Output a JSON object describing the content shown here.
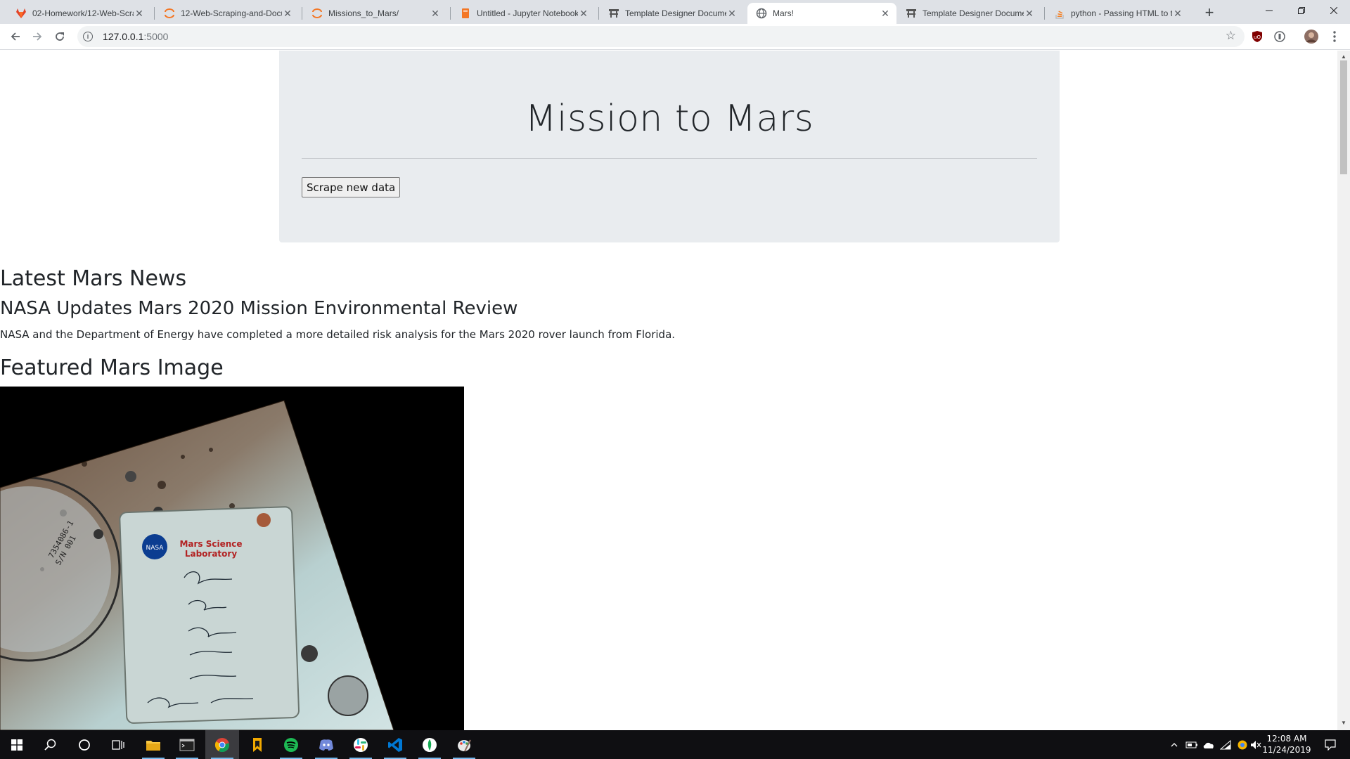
{
  "browser": {
    "tabs": [
      {
        "title": "02-Homework/12-Web-Scrap",
        "favicon": "gitlab-icon"
      },
      {
        "title": "12-Web-Scraping-and-Docu",
        "favicon": "jupyter-icon"
      },
      {
        "title": "Missions_to_Mars/",
        "favicon": "jupyter-icon"
      },
      {
        "title": "Untitled - Jupyter Notebook",
        "favicon": "jupyter-notebook-icon"
      },
      {
        "title": "Template Designer Docume",
        "favicon": "jinja-icon"
      },
      {
        "title": "Mars!",
        "favicon": "globe-icon",
        "active": true
      },
      {
        "title": "Template Designer Docume",
        "favicon": "jinja-icon"
      },
      {
        "title": "python - Passing HTML to t",
        "favicon": "stackoverflow-icon"
      }
    ],
    "url_host": "127.0.0.1",
    "url_port": ":5000"
  },
  "page": {
    "title": "Mission to Mars",
    "scrape_button": "Scrape new data",
    "news_heading": "Latest Mars News",
    "news_title": "NASA Updates Mars 2020 Mission Environmental Review",
    "news_teaser": "NASA and the Department of Energy have completed a more detailed risk analysis for the Mars 2020 rover launch from Florida.",
    "featured_heading": "Featured Mars Image",
    "featured_image": {
      "plate_text_1": "Mars Science",
      "plate_text_2": "Laboratory",
      "nasa_logo": "NASA",
      "part_number": "7354086-1",
      "serial_number": "S/N 001"
    }
  },
  "taskbar": {
    "apps": [
      "start-icon",
      "search-icon",
      "cortana-icon",
      "task-view-icon",
      "file-explorer-icon",
      "terminal-icon",
      "chrome-icon",
      "bookmark-app-icon",
      "spotify-icon",
      "discord-icon",
      "slack-icon",
      "vscode-icon",
      "mongodb-icon",
      "paint-icon"
    ],
    "time": "12:08 AM",
    "date": "11/24/2019"
  }
}
